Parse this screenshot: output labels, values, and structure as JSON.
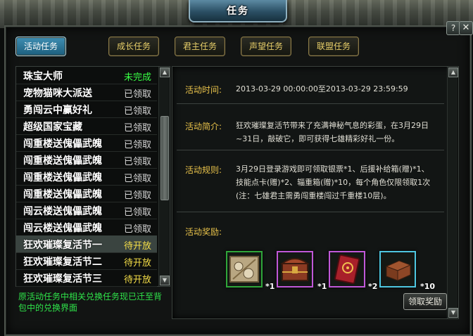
{
  "window": {
    "title": "任务",
    "help_label": "?",
    "close_label": "✕"
  },
  "tabs": [
    {
      "label": "活动任务",
      "active": true
    },
    {
      "label": "成长任务",
      "active": false
    },
    {
      "label": "君主任务",
      "active": false
    },
    {
      "label": "声望任务",
      "active": false
    },
    {
      "label": "联盟任务",
      "active": false
    }
  ],
  "task_list": [
    {
      "name": "珠宝大师",
      "status": "未完成",
      "status_color": "#38ff44"
    },
    {
      "name": "宠物猫咪大派送",
      "status": "已领取",
      "status_color": "#d6d6d6"
    },
    {
      "name": "勇闯云中赢好礼",
      "status": "已领取",
      "status_color": "#d6d6d6"
    },
    {
      "name": "超级国家宝藏",
      "status": "已领取",
      "status_color": "#d6d6d6"
    },
    {
      "name": "闯重楼送傀儡武魄",
      "status": "已领取",
      "status_color": "#d6d6d6"
    },
    {
      "name": "闯重楼送傀儡武魄",
      "status": "已领取",
      "status_color": "#d6d6d6"
    },
    {
      "name": "闯重楼送傀儡武魄",
      "status": "已领取",
      "status_color": "#d6d6d6"
    },
    {
      "name": "闯重楼送傀儡武魄",
      "status": "已领取",
      "status_color": "#d6d6d6"
    },
    {
      "name": "闯云楼送傀儡武魄",
      "status": "已领取",
      "status_color": "#d6d6d6"
    },
    {
      "name": "闯云楼送傀儡武魄",
      "status": "已领取",
      "status_color": "#d6d6d6"
    },
    {
      "name": "狂欢璀璨复活节一",
      "status": "待开放",
      "status_color": "#f6df48",
      "selected": true
    },
    {
      "name": "狂欢璀璨复活节二",
      "status": "待开放",
      "status_color": "#f6df48"
    },
    {
      "name": "狂欢璀璨复活节三",
      "status": "待开放",
      "status_color": "#f6df48"
    }
  ],
  "list_note": "原活动任务中相关兑换任务现已迁至背包中的兑换界面",
  "detail": {
    "time_label": "活动时间:",
    "time_value": "2013-03-29 00:00:00至2013-03-29 23:59:59",
    "intro_label": "活动简介:",
    "intro_value": "狂欢璀璨复活节带来了充满神秘气息的彩蛋，在3月29日~31日，敲破它，即可获得七雄精彩好礼一份。",
    "rules_label": "活动规则:",
    "rules_value": "3月29日登录游戏即可领取银票*1、后援补给箱(赠)*1、技能点卡(赠)*2、辎重箱(赠)*10，每个角色仅限领取1次(注：七雄君主需勇闯重楼闯过千重楼10层)。",
    "reward_label": "活动奖励:",
    "rewards": [
      {
        "icon": "silver-note-icon",
        "count": "",
        "border": "#2fa63a"
      },
      {
        "icon": "support-chest-icon",
        "count": "*1",
        "border": "#c058d8"
      },
      {
        "icon": "skill-card-icon",
        "count": "*1",
        "border": "#c058d8"
      },
      {
        "icon": "supply-box-icon",
        "count": "*2",
        "border": "#4ec6e0"
      }
    ],
    "last_count": "*10",
    "claim_label": "领取奖励"
  }
}
